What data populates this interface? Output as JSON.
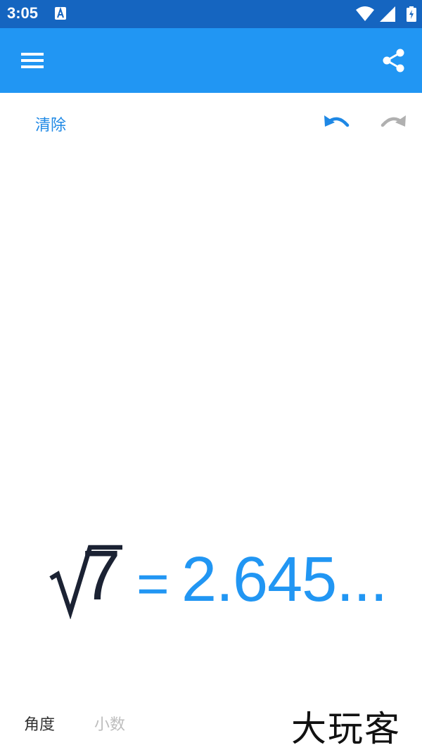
{
  "status_bar": {
    "time": "3:05",
    "colors": {
      "background": "#1565c0",
      "foreground": "#ffffff"
    },
    "icons": [
      "notification-a-icon",
      "wifi-icon",
      "cellular-signal-icon",
      "battery-charging-icon"
    ]
  },
  "app_bar": {
    "color": "#2196f3",
    "icons": [
      "menu-icon",
      "share-icon"
    ]
  },
  "toolbar": {
    "clear_label": "清除",
    "accent_color": "#1e88e5",
    "icons": [
      "undo-icon",
      "redo-icon"
    ]
  },
  "expression": {
    "radicand": "7",
    "equals": "=",
    "result": "2.645...",
    "result_color": "#2196f3"
  },
  "bottom": {
    "angle_label": "角度",
    "decimal_label": "小数",
    "watermark": "大玩客"
  }
}
